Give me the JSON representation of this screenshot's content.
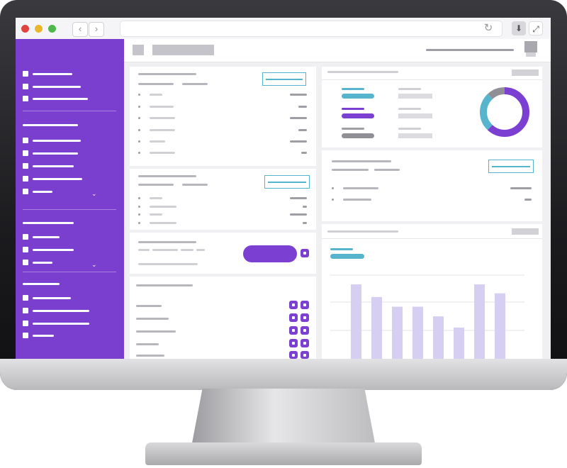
{
  "window": {
    "title": ""
  },
  "toolbar": {
    "back_icon": "chevron-left-icon",
    "forward_icon": "chevron-right-icon",
    "reload_icon": "reload-icon",
    "download_icon": "download-icon",
    "expand_icon": "expand-icon"
  },
  "colors": {
    "sidebar": "#7a3fcf",
    "accent_purple": "#7b3fd1",
    "accent_teal": "#56b5cc",
    "bar_fill": "#d6cff1",
    "donut_grey": "#8f8f95"
  },
  "sidebar": {
    "groups": [
      {
        "items": 3,
        "has_dropdown": false
      },
      {
        "items": 5,
        "has_dropdown": true
      },
      {
        "items": 3,
        "has_dropdown": true
      },
      {
        "items": 4,
        "has_dropdown": false
      }
    ]
  },
  "donut": {
    "segments": [
      {
        "color": "#7b3fd1",
        "fraction": 0.62
      },
      {
        "color": "#56b5cc",
        "fraction": 0.26
      },
      {
        "color": "#8f8f95",
        "fraction": 0.12
      }
    ]
  },
  "chart_data": {
    "type": "bar",
    "title": "",
    "xlabel": "",
    "ylabel": "",
    "categories": [
      "",
      "",
      "",
      "",
      "",
      "",
      "",
      "",
      ""
    ],
    "values": [
      100,
      83,
      70,
      70,
      57,
      42,
      100,
      88
    ],
    "ylim": [
      0,
      100
    ],
    "grid": true,
    "bar_color": "#d6cff1"
  }
}
